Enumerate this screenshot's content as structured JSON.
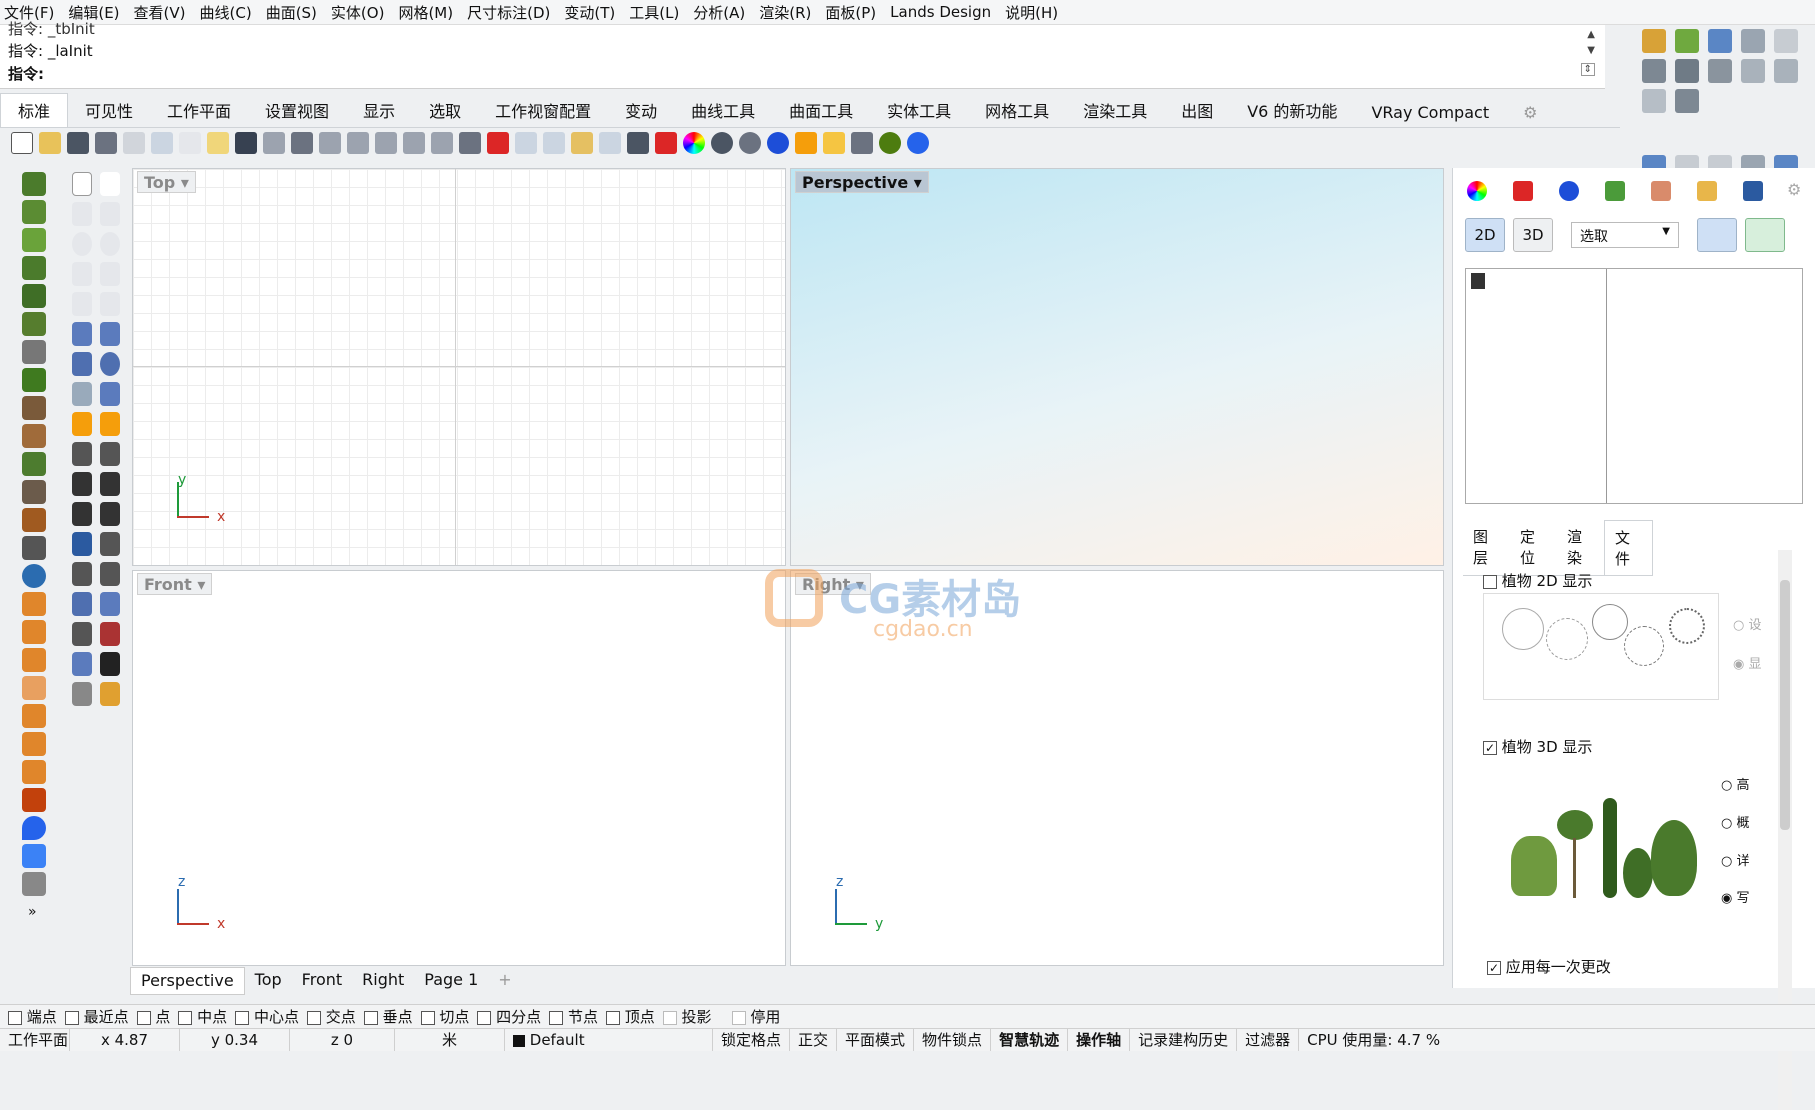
{
  "menu": [
    "文件(F)",
    "编辑(E)",
    "查看(V)",
    "曲线(C)",
    "曲面(S)",
    "实体(O)",
    "网格(M)",
    "尺寸标注(D)",
    "变动(T)",
    "工具(L)",
    "分析(A)",
    "渲染(R)",
    "面板(P)",
    "Lands Design",
    "说明(H)"
  ],
  "command": {
    "history1": "指令: _tbInit",
    "history2": "指令: _laInit",
    "prompt": "指令:",
    "value": ""
  },
  "tabs": [
    "标准",
    "可见性",
    "工作平面",
    "设置视图",
    "显示",
    "选取",
    "工作视窗配置",
    "变动",
    "曲线工具",
    "曲面工具",
    "实体工具",
    "网格工具",
    "渲染工具",
    "出图",
    "V6 的新功能",
    "VRay Compact"
  ],
  "viewports": {
    "top": {
      "label": "Top",
      "axis1": "y",
      "axis2": "x"
    },
    "perspective": {
      "label": "Perspective"
    },
    "front": {
      "label": "Front",
      "axis1": "z",
      "axis2": "x"
    },
    "right": {
      "label": "Right",
      "axis1": "z",
      "axis2": "y"
    }
  },
  "watermark": {
    "line1": "CG素材岛",
    "line2": "cgdao.cn"
  },
  "viewport_tabs": [
    "Perspective",
    "Top",
    "Front",
    "Right",
    "Page 1"
  ],
  "panel": {
    "btn2d": "2D",
    "btn3d": "3D",
    "select_value": "选取",
    "tabs": [
      "图层",
      "定位",
      "渲染",
      "文件"
    ],
    "plant2d_label": "植物 2D 显示",
    "plant3d_label": "植物 3D 显示",
    "radio2d": [
      "设",
      "显"
    ],
    "radio3d": [
      "高",
      "概",
      "详",
      "写"
    ],
    "apply_label": "应用每一次更改"
  },
  "snaps": [
    "端点",
    "最近点",
    "点",
    "中点",
    "中心点",
    "交点",
    "垂点",
    "切点",
    "四分点",
    "节点",
    "顶点",
    "投影",
    "停用"
  ],
  "status": {
    "plane": "工作平面",
    "x": "x 4.87",
    "y": "y 0.34",
    "z": "z 0",
    "unit": "米",
    "layer": "Default",
    "items": [
      "锁定格点",
      "正交",
      "平面模式",
      "物件锁点",
      "智慧轨迹",
      "操作轴",
      "记录建构历史",
      "过滤器"
    ],
    "cpu": "CPU 使用量: 4.7 %"
  }
}
